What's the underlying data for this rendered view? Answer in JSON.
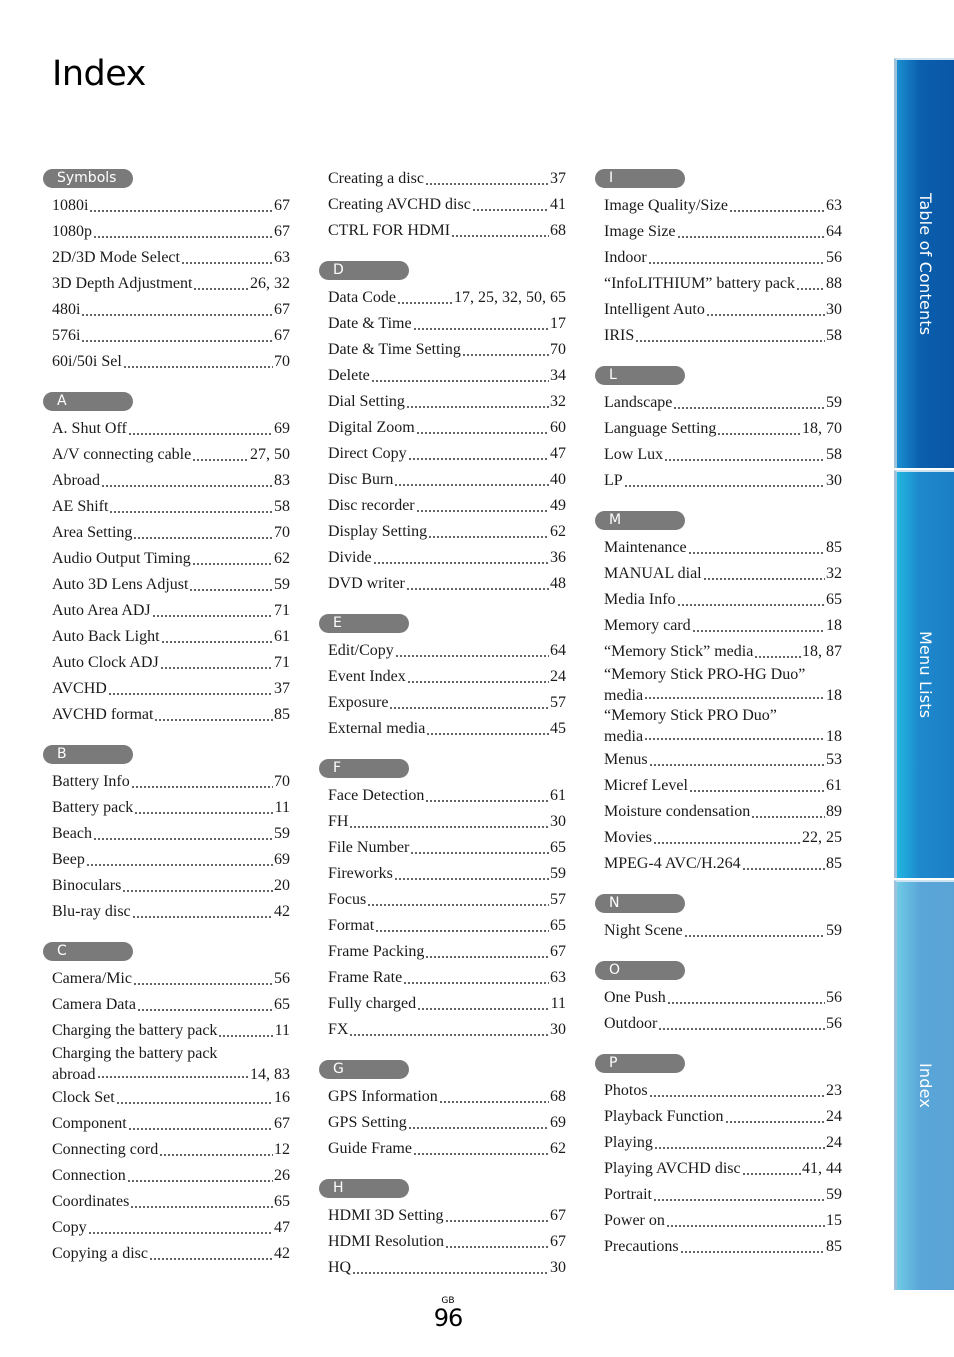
{
  "title": "Index",
  "footer": {
    "region": "GB",
    "page": "96"
  },
  "side_tabs": [
    {
      "label": "Table of Contents",
      "active": false
    },
    {
      "label": "Menu Lists",
      "active": false
    },
    {
      "label": "Index",
      "active": true
    }
  ],
  "columns": [
    [
      {
        "letter": "Symbols",
        "entries": [
          {
            "term": "1080i",
            "pages": "67"
          },
          {
            "term": "1080p",
            "pages": "67"
          },
          {
            "term": "2D/3D Mode Select",
            "pages": "63"
          },
          {
            "term": "3D Depth Adjustment",
            "pages": "26, 32"
          },
          {
            "term": "480i",
            "pages": "67"
          },
          {
            "term": "576i",
            "pages": "67"
          },
          {
            "term": "60i/50i Sel",
            "pages": "70"
          }
        ]
      },
      {
        "letter": "A",
        "entries": [
          {
            "term": "A. Shut Off",
            "pages": "69"
          },
          {
            "term": "A/V connecting cable",
            "pages": "27, 50"
          },
          {
            "term": "Abroad",
            "pages": "83"
          },
          {
            "term": "AE Shift",
            "pages": "58"
          },
          {
            "term": "Area Setting",
            "pages": "70"
          },
          {
            "term": "Audio Output Timing",
            "pages": "62"
          },
          {
            "term": "Auto 3D Lens Adjust",
            "pages": "59"
          },
          {
            "term": "Auto Area ADJ",
            "pages": "71"
          },
          {
            "term": "Auto Back Light",
            "pages": "61"
          },
          {
            "term": "Auto Clock ADJ",
            "pages": "71"
          },
          {
            "term": "AVCHD",
            "pages": "37"
          },
          {
            "term": "AVCHD format",
            "pages": "85"
          }
        ]
      },
      {
        "letter": "B",
        "entries": [
          {
            "term": "Battery Info",
            "pages": "70"
          },
          {
            "term": "Battery pack",
            "pages": "11"
          },
          {
            "term": "Beach",
            "pages": "59"
          },
          {
            "term": "Beep",
            "pages": "69"
          },
          {
            "term": "Binoculars",
            "pages": "20"
          },
          {
            "term": "Blu-ray disc",
            "pages": "42"
          }
        ]
      },
      {
        "letter": "C",
        "entries": [
          {
            "term": "Camera/Mic",
            "pages": "56"
          },
          {
            "term": "Camera Data",
            "pages": "65"
          },
          {
            "term": "Charging the battery pack",
            "pages": "11"
          },
          {
            "term": "Charging the battery pack",
            "term_cont": "abroad",
            "pages": "14, 83"
          },
          {
            "term": "Clock Set",
            "pages": "16"
          },
          {
            "term": "Component",
            "pages": "67"
          },
          {
            "term": "Connecting cord",
            "pages": "12"
          },
          {
            "term": "Connection",
            "pages": "26"
          },
          {
            "term": "Coordinates",
            "pages": "65"
          },
          {
            "term": "Copy",
            "pages": "47"
          },
          {
            "term": "Copying a disc",
            "pages": "42"
          }
        ]
      }
    ],
    [
      {
        "letter": "",
        "entries": [
          {
            "term": "Creating a disc",
            "pages": "37"
          },
          {
            "term": "Creating AVCHD disc",
            "pages": "41"
          },
          {
            "term": "CTRL FOR HDMI",
            "pages": "68"
          }
        ]
      },
      {
        "letter": "D",
        "entries": [
          {
            "term": "Data Code",
            "pages": "17, 25, 32, 50, 65"
          },
          {
            "term": "Date & Time",
            "pages": "17"
          },
          {
            "term": "Date & Time Setting",
            "pages": "70"
          },
          {
            "term": "Delete",
            "pages": "34"
          },
          {
            "term": "Dial Setting",
            "pages": "32"
          },
          {
            "term": "Digital Zoom",
            "pages": "60"
          },
          {
            "term": "Direct Copy",
            "pages": "47"
          },
          {
            "term": "Disc Burn",
            "pages": "40"
          },
          {
            "term": "Disc recorder",
            "pages": "49"
          },
          {
            "term": "Display Setting",
            "pages": "62"
          },
          {
            "term": "Divide",
            "pages": "36"
          },
          {
            "term": "DVD writer",
            "pages": "48"
          }
        ]
      },
      {
        "letter": "E",
        "entries": [
          {
            "term": "Edit/Copy",
            "pages": "64"
          },
          {
            "term": "Event Index",
            "pages": "24"
          },
          {
            "term": "Exposure",
            "pages": "57"
          },
          {
            "term": "External media",
            "pages": "45"
          }
        ]
      },
      {
        "letter": "F",
        "entries": [
          {
            "term": "Face Detection",
            "pages": "61"
          },
          {
            "term": "FH",
            "pages": "30"
          },
          {
            "term": "File Number",
            "pages": "65"
          },
          {
            "term": "Fireworks",
            "pages": "59"
          },
          {
            "term": "Focus",
            "pages": "57"
          },
          {
            "term": "Format",
            "pages": "65"
          },
          {
            "term": "Frame Packing",
            "pages": "67"
          },
          {
            "term": "Frame Rate",
            "pages": "63"
          },
          {
            "term": "Fully charged",
            "pages": "11"
          },
          {
            "term": "FX",
            "pages": "30"
          }
        ]
      },
      {
        "letter": "G",
        "entries": [
          {
            "term": "GPS Information",
            "pages": "68"
          },
          {
            "term": "GPS Setting",
            "pages": "69"
          },
          {
            "term": "Guide Frame",
            "pages": "62"
          }
        ]
      },
      {
        "letter": "H",
        "entries": [
          {
            "term": "HDMI 3D Setting",
            "pages": "67"
          },
          {
            "term": "HDMI Resolution",
            "pages": "67"
          },
          {
            "term": "HQ",
            "pages": "30"
          }
        ]
      }
    ],
    [
      {
        "letter": "I",
        "entries": [
          {
            "term": "Image Quality/Size",
            "pages": "63"
          },
          {
            "term": "Image Size",
            "pages": "64"
          },
          {
            "term": "Indoor",
            "pages": "56"
          },
          {
            "term": "“InfoLITHIUM” battery pack",
            "pages": "88"
          },
          {
            "term": "Intelligent Auto",
            "pages": "30"
          },
          {
            "term": "IRIS",
            "pages": "58"
          }
        ]
      },
      {
        "letter": "L",
        "entries": [
          {
            "term": "Landscape",
            "pages": "59"
          },
          {
            "term": "Language Setting",
            "pages": "18, 70"
          },
          {
            "term": "Low Lux",
            "pages": "58"
          },
          {
            "term": "LP",
            "pages": "30"
          }
        ]
      },
      {
        "letter": "M",
        "entries": [
          {
            "term": "Maintenance",
            "pages": "85"
          },
          {
            "term": "MANUAL dial",
            "pages": "32"
          },
          {
            "term": "Media Info",
            "pages": "65"
          },
          {
            "term": "Memory card",
            "pages": "18"
          },
          {
            "term": "“Memory Stick” media",
            "pages": "18, 87"
          },
          {
            "term": "“Memory Stick PRO-HG Duo”",
            "term_cont": "media",
            "pages": "18"
          },
          {
            "term": "“Memory Stick PRO Duo”",
            "term_cont": "media",
            "pages": "18"
          },
          {
            "term": "Menus",
            "pages": "53"
          },
          {
            "term": "Micref Level",
            "pages": "61"
          },
          {
            "term": "Moisture condensation",
            "pages": "89"
          },
          {
            "term": "Movies",
            "pages": "22, 25"
          },
          {
            "term": "MPEG-4 AVC/H.264",
            "pages": "85"
          }
        ]
      },
      {
        "letter": "N",
        "entries": [
          {
            "term": "Night Scene",
            "pages": "59"
          }
        ]
      },
      {
        "letter": "O",
        "entries": [
          {
            "term": "One Push",
            "pages": "56"
          },
          {
            "term": "Outdoor",
            "pages": "56"
          }
        ]
      },
      {
        "letter": "P",
        "entries": [
          {
            "term": "Photos",
            "pages": "23"
          },
          {
            "term": "Playback Function",
            "pages": "24"
          },
          {
            "term": "Playing",
            "pages": "24"
          },
          {
            "term": "Playing AVCHD disc",
            "pages": "41, 44"
          },
          {
            "term": "Portrait",
            "pages": "59"
          },
          {
            "term": "Power on",
            "pages": "15"
          },
          {
            "term": "Precautions",
            "pages": "85"
          }
        ]
      }
    ]
  ]
}
